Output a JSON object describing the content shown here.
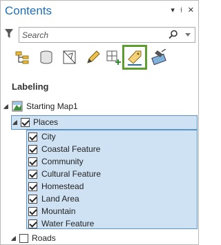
{
  "pane": {
    "title": "Contents",
    "controls": [
      "▾",
      "⫮",
      "✕"
    ]
  },
  "search": {
    "placeholder": "Search"
  },
  "toolbar": {
    "tools": [
      "list-by-drawing-order-icon",
      "list-by-data-source-icon",
      "list-by-selection-icon",
      "list-by-editing-icon",
      "list-by-snapping-icon",
      "list-by-labeling-icon",
      "list-perspective-imagery-icon"
    ],
    "active": "list-by-labeling-icon"
  },
  "section": {
    "heading": "Labeling"
  },
  "tree": {
    "map_name": "Starting Map1",
    "group": {
      "label": "Places",
      "checked": true
    },
    "classes": [
      {
        "label": "City",
        "checked": true
      },
      {
        "label": "Coastal Feature",
        "checked": true
      },
      {
        "label": "Community",
        "checked": true
      },
      {
        "label": "Cultural Feature",
        "checked": true
      },
      {
        "label": "Homestead",
        "checked": true
      },
      {
        "label": "Land Area",
        "checked": true
      },
      {
        "label": "Mountain",
        "checked": true
      },
      {
        "label": "Water Feature",
        "checked": true
      }
    ],
    "next_layer": {
      "label": "Roads",
      "checked": false
    }
  },
  "colors": {
    "title": "#1f6fb8",
    "selection_fill": "#cfe2f3",
    "selection_border": "#5a93c9",
    "active_tool_border": "#5b9e2f"
  }
}
